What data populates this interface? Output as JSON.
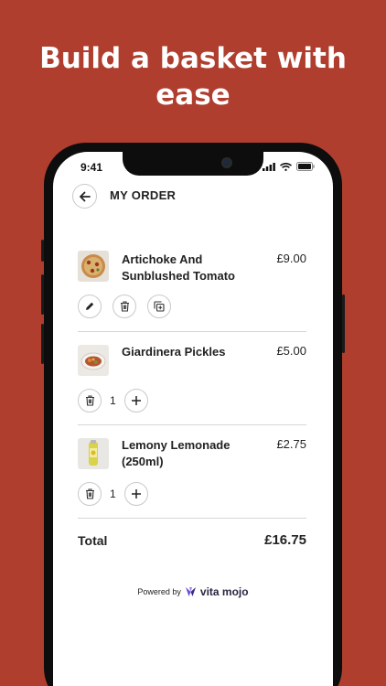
{
  "headline": "Build a basket with ease",
  "status_bar": {
    "time": "9:41"
  },
  "header": {
    "title": "MY ORDER"
  },
  "items": [
    {
      "name": "Artichoke And Sunblushed Tomato",
      "price": "£9.00",
      "image": "pizza"
    },
    {
      "name": "Giardinera Pickles",
      "price": "£5.00",
      "quantity": "1",
      "image": "pickles"
    },
    {
      "name": "Lemony Lemonade (250ml)",
      "price": "£2.75",
      "quantity": "1",
      "image": "lemonade"
    }
  ],
  "total": {
    "label": "Total",
    "value": "£16.75"
  },
  "footer": {
    "powered_by": "Powered by",
    "brand": "vita mojo"
  },
  "colors": {
    "background": "#b03e2e",
    "screen": "#ffffff",
    "text": "#222222",
    "brand": "#2a2640"
  },
  "icons": [
    "back-arrow-icon",
    "pencil-icon",
    "trash-icon",
    "duplicate-icon",
    "plus-icon",
    "signal-icon",
    "wifi-icon",
    "battery-icon"
  ]
}
